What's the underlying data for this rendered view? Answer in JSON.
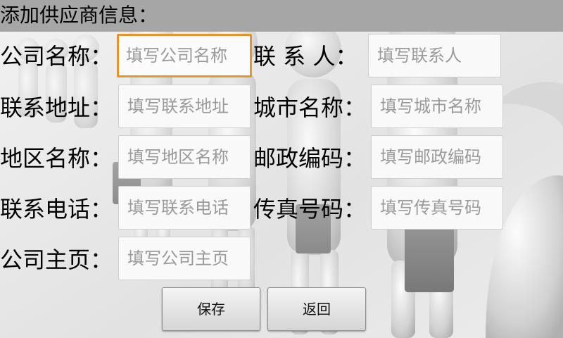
{
  "header": {
    "title": "添加供应商信息："
  },
  "form": {
    "company_name": {
      "label": "公司名称：",
      "placeholder": "填写公司名称"
    },
    "contact_person": {
      "label": "联 系 人：",
      "placeholder": "填写联系人"
    },
    "address": {
      "label": "联系地址：",
      "placeholder": "填写联系地址"
    },
    "city": {
      "label": "城市名称：",
      "placeholder": "填写城市名称"
    },
    "region": {
      "label": "地区名称：",
      "placeholder": "填写地区名称"
    },
    "postal_code": {
      "label": "邮政编码：",
      "placeholder": "填写邮政编码"
    },
    "phone": {
      "label": "联系电话：",
      "placeholder": "填写联系电话"
    },
    "fax": {
      "label": "传真号码：",
      "placeholder": "填写传真号码"
    },
    "homepage": {
      "label": "公司主页：",
      "placeholder": "填写公司主页"
    }
  },
  "buttons": {
    "save": "保存",
    "back": "返回"
  },
  "colors": {
    "title_bar": "#a6a6a6",
    "focus_border": "#e6952a",
    "background": "#e9e9e9"
  }
}
